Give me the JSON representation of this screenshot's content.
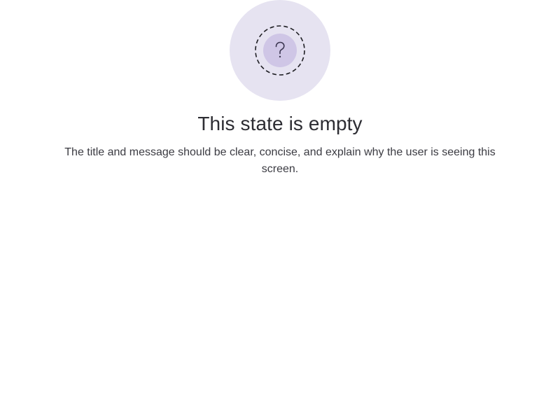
{
  "empty_state": {
    "icon": "question-mark-icon",
    "title": "This state is empty",
    "message": "The title and message should be clear, concise, and explain why the user is seeing this screen."
  },
  "colors": {
    "outer_circle": "#e6e3f1",
    "inner_circle": "#cfc6e6",
    "dashed_ring": "#1f1f24",
    "question_mark": "#3a3550"
  }
}
